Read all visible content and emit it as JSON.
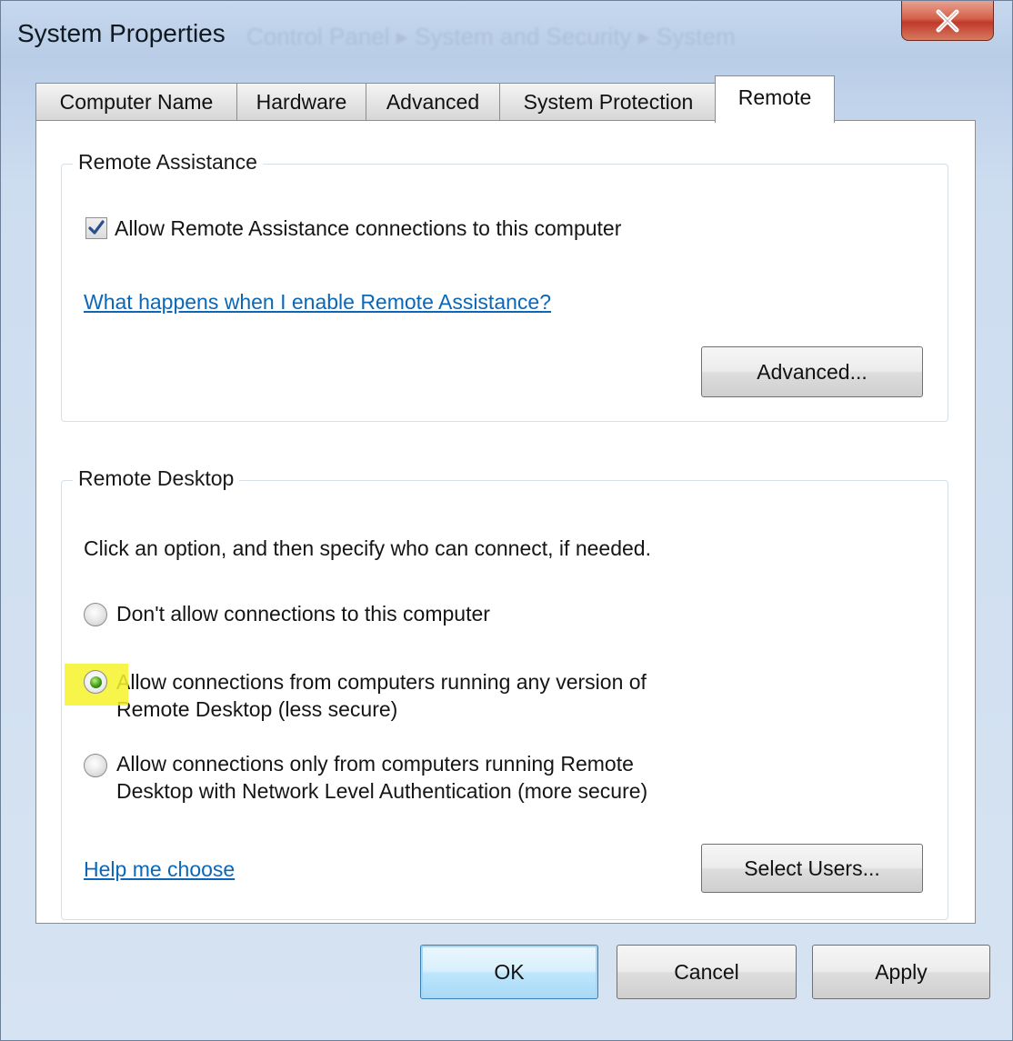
{
  "window": {
    "title": "System Properties",
    "background_breadcrumb": "Control Panel  ▸  System and Security  ▸  System"
  },
  "tabs": [
    {
      "label": "Computer Name",
      "active": false
    },
    {
      "label": "Hardware",
      "active": false
    },
    {
      "label": "Advanced",
      "active": false
    },
    {
      "label": "System Protection",
      "active": false
    },
    {
      "label": "Remote",
      "active": true
    }
  ],
  "remote_assistance": {
    "title": "Remote Assistance",
    "allow_checkbox_label": "Allow Remote Assistance connections to this computer",
    "allow_checked": true,
    "help_link": "What happens when I enable Remote Assistance?",
    "advanced_button": "Advanced..."
  },
  "remote_desktop": {
    "title": "Remote Desktop",
    "instruction": "Click an option, and then specify who can connect, if needed.",
    "options": [
      {
        "line1": "Don't allow connections to this computer",
        "line2": "",
        "selected": false
      },
      {
        "line1": "Allow connections from computers running any version of",
        "line2": "Remote Desktop (less secure)",
        "selected": true
      },
      {
        "line1": "Allow connections only from computers running Remote",
        "line2": "Desktop with Network Level Authentication (more secure)",
        "selected": false
      }
    ],
    "help_link": "Help me choose",
    "select_users_button": "Select Users..."
  },
  "footer": {
    "ok": "OK",
    "cancel": "Cancel",
    "apply": "Apply"
  },
  "colors": {
    "link": "#0b67b7",
    "highlight": "#f7f32a",
    "selected_radio": "#3f9a1a",
    "close_button": "#c0392b"
  }
}
